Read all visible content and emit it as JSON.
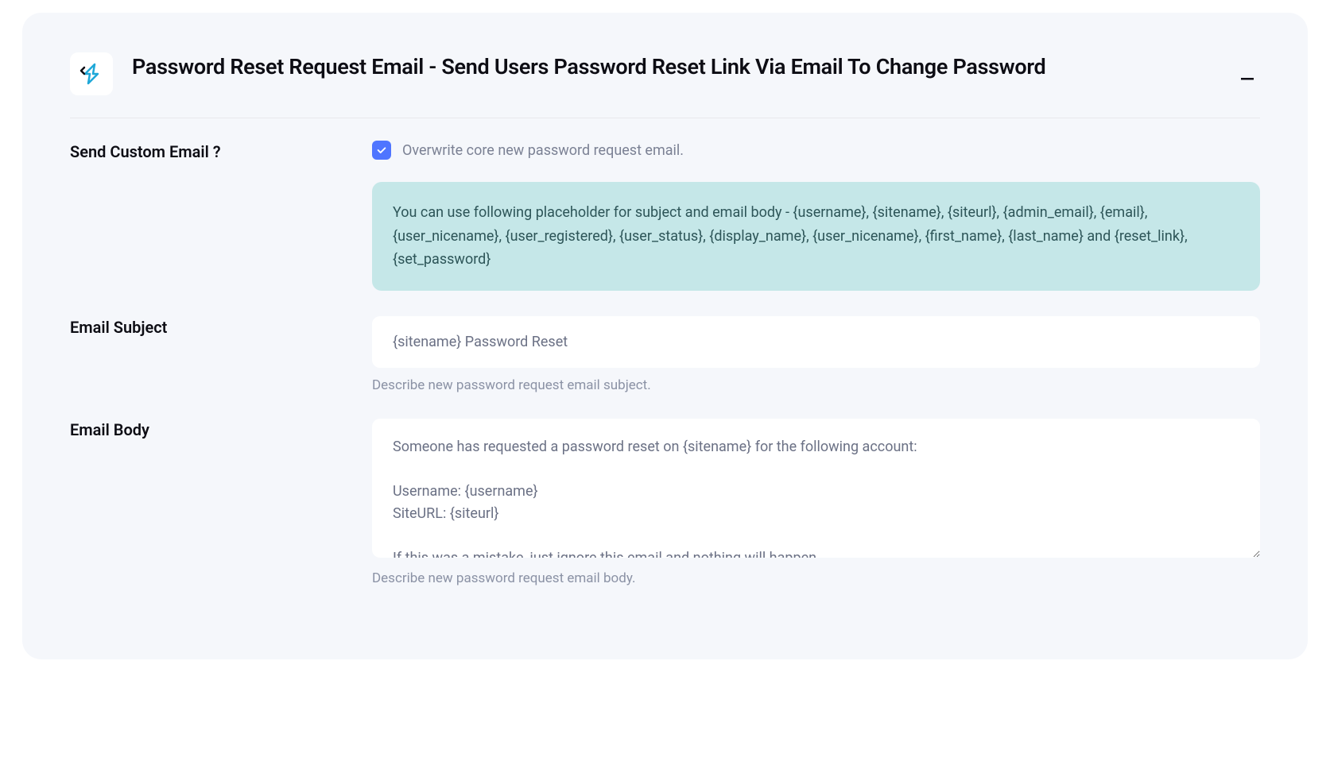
{
  "panel": {
    "title": "Password Reset Request Email - Send Users Password Reset Link Via Email To Change Password"
  },
  "sendCustomEmail": {
    "label": "Send Custom Email ?",
    "checkboxLabel": "Overwrite core new password request email.",
    "infoText": "You can use following placeholder for subject and email body - {username}, {sitename}, {siteurl}, {admin_email}, {email}, {user_nicename}, {user_registered}, {user_status}, {display_name}, {user_nicename}, {first_name}, {last_name} and {reset_link}, {set_password}"
  },
  "emailSubject": {
    "label": "Email Subject",
    "value": "{sitename} Password Reset",
    "helpText": "Describe new password request email subject."
  },
  "emailBody": {
    "label": "Email Body",
    "value": "Someone has requested a password reset on {sitename} for the following account:\n\nUsername: {username}\nSiteURL: {siteurl}\n\nIf this was a mistake, just ignore this email and nothing will happen.",
    "helpText": "Describe new password request email body."
  }
}
